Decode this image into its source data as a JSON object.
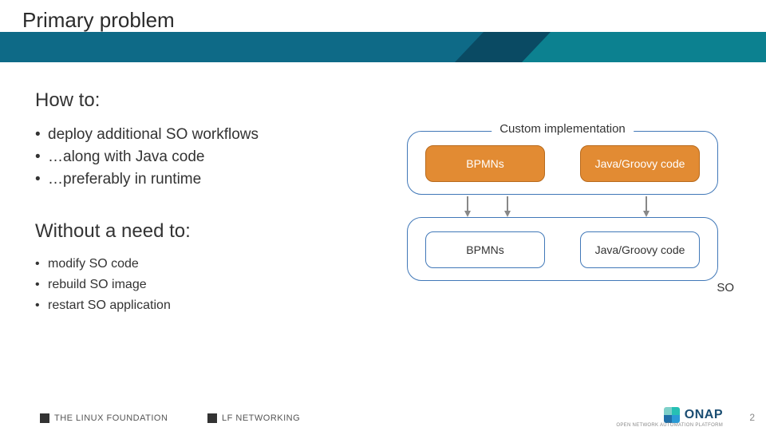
{
  "title": "Primary problem",
  "howto": {
    "heading": "How to:",
    "items": [
      "deploy additional SO workflows",
      "…along with Java code",
      "…preferably in runtime"
    ]
  },
  "without": {
    "heading": "Without a need to:",
    "items": [
      "modify SO code",
      "rebuild SO image",
      "restart SO application"
    ]
  },
  "diagram": {
    "custom_label": "Custom implementation",
    "so_label": "SO",
    "top_left": "BPMNs",
    "top_right": "Java/Groovy code",
    "bottom_left": "BPMNs",
    "bottom_right": "Java/Groovy code"
  },
  "footer": {
    "linux_foundation": "THE LINUX FOUNDATION",
    "lf_networking": "LF NETWORKING",
    "onap": "ONAP",
    "onap_sub": "OPEN NETWORK AUTOMATION PLATFORM",
    "page": "2"
  }
}
